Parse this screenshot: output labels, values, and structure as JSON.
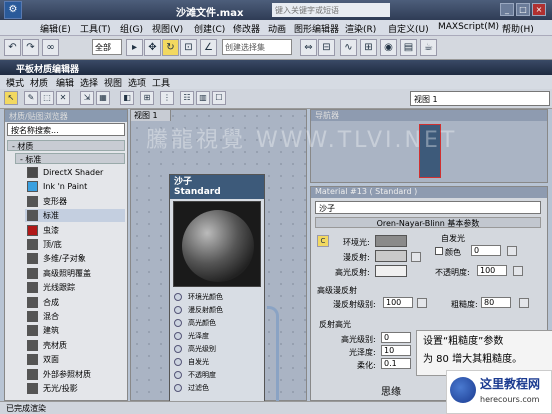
{
  "titlebar": {
    "title": "沙滩文件.max",
    "search": "键入关键字或短语"
  },
  "menubar": [
    "编辑(E)",
    "工具(T)",
    "组(G)",
    "视图(V)",
    "创建(C)",
    "修改器",
    "动画",
    "图形编辑器",
    "渲染(R)",
    "自定义(U)",
    "MAXScript(M)",
    "帮助(H)"
  ],
  "toolbar": {
    "filter": "全部",
    "selset": "创建选择集"
  },
  "me": {
    "title": "平板材质编辑器",
    "menu": [
      "模式",
      "材质",
      "编辑",
      "选择",
      "视图",
      "选项",
      "工具"
    ],
    "view_select": "视图 1"
  },
  "browser": {
    "header": "材质/贴图浏览器",
    "search": "按名称搜索...",
    "group_material": "- 材质",
    "group_standard": "- 标准",
    "items": [
      {
        "label": "DirectX Shader",
        "color": "#4a4a4a"
      },
      {
        "label": "Ink 'n Paint",
        "color": "#3aa0e0"
      },
      {
        "label": "变形器",
        "color": "#555"
      },
      {
        "label": "标准",
        "color": "#555"
      },
      {
        "label": "虫漆",
        "color": "#b01818"
      },
      {
        "label": "顶/底",
        "color": "#555"
      },
      {
        "label": "多维/子对象",
        "color": "#555"
      },
      {
        "label": "高级照明覆盖",
        "color": "#555"
      },
      {
        "label": "光线跟踪",
        "color": "#555"
      },
      {
        "label": "合成",
        "color": "#555"
      },
      {
        "label": "混合",
        "color": "#555"
      },
      {
        "label": "建筑",
        "color": "#555"
      },
      {
        "label": "壳材质",
        "color": "#555"
      },
      {
        "label": "双面",
        "color": "#555"
      },
      {
        "label": "外部参照材质",
        "color": "#555"
      },
      {
        "label": "无光/投影",
        "color": "#555"
      }
    ]
  },
  "view": {
    "tab": "视图 1"
  },
  "node": {
    "name": "沙子",
    "type": "Standard",
    "slots": [
      "环境光颜色",
      "漫反射颜色",
      "高光颜色",
      "光泽度",
      "高光级别",
      "自发光",
      "不透明度",
      "过滤色"
    ]
  },
  "navigator": {
    "header": "导航器"
  },
  "params": {
    "header": "Material #13 ( Standard )",
    "name": "沙子",
    "rollout": "Oren-Nayar-Blinn 基本参数",
    "ambient": "环境光:",
    "diffuse": "漫反射:",
    "specular": "高光反射:",
    "self_illum": "自发光",
    "color_label": "颜色",
    "color_val": "0",
    "opacity_label": "不透明度:",
    "opacity_val": "100",
    "advanced": "高级漫反射",
    "diff_level": "漫反射级别:",
    "diff_level_val": "100",
    "roughness": "粗糙度:",
    "roughness_val": "80",
    "spec_hl": "反射高光",
    "spec_level": "高光级别:",
    "spec_level_val": "0",
    "gloss": "光泽度:",
    "gloss_val": "10",
    "soften": "柔化:",
    "soften_val": "0.1",
    "tail": "思缘"
  },
  "status": "已完成渲染",
  "callout": {
    "line1": "设置“粗糙度”参数",
    "line2": "为 80 增大其粗糙度。"
  },
  "watermark": "騰龍視覺 WWW.TLVI.NET",
  "logo": {
    "name": "这里教程网",
    "url": "herecours.com"
  }
}
